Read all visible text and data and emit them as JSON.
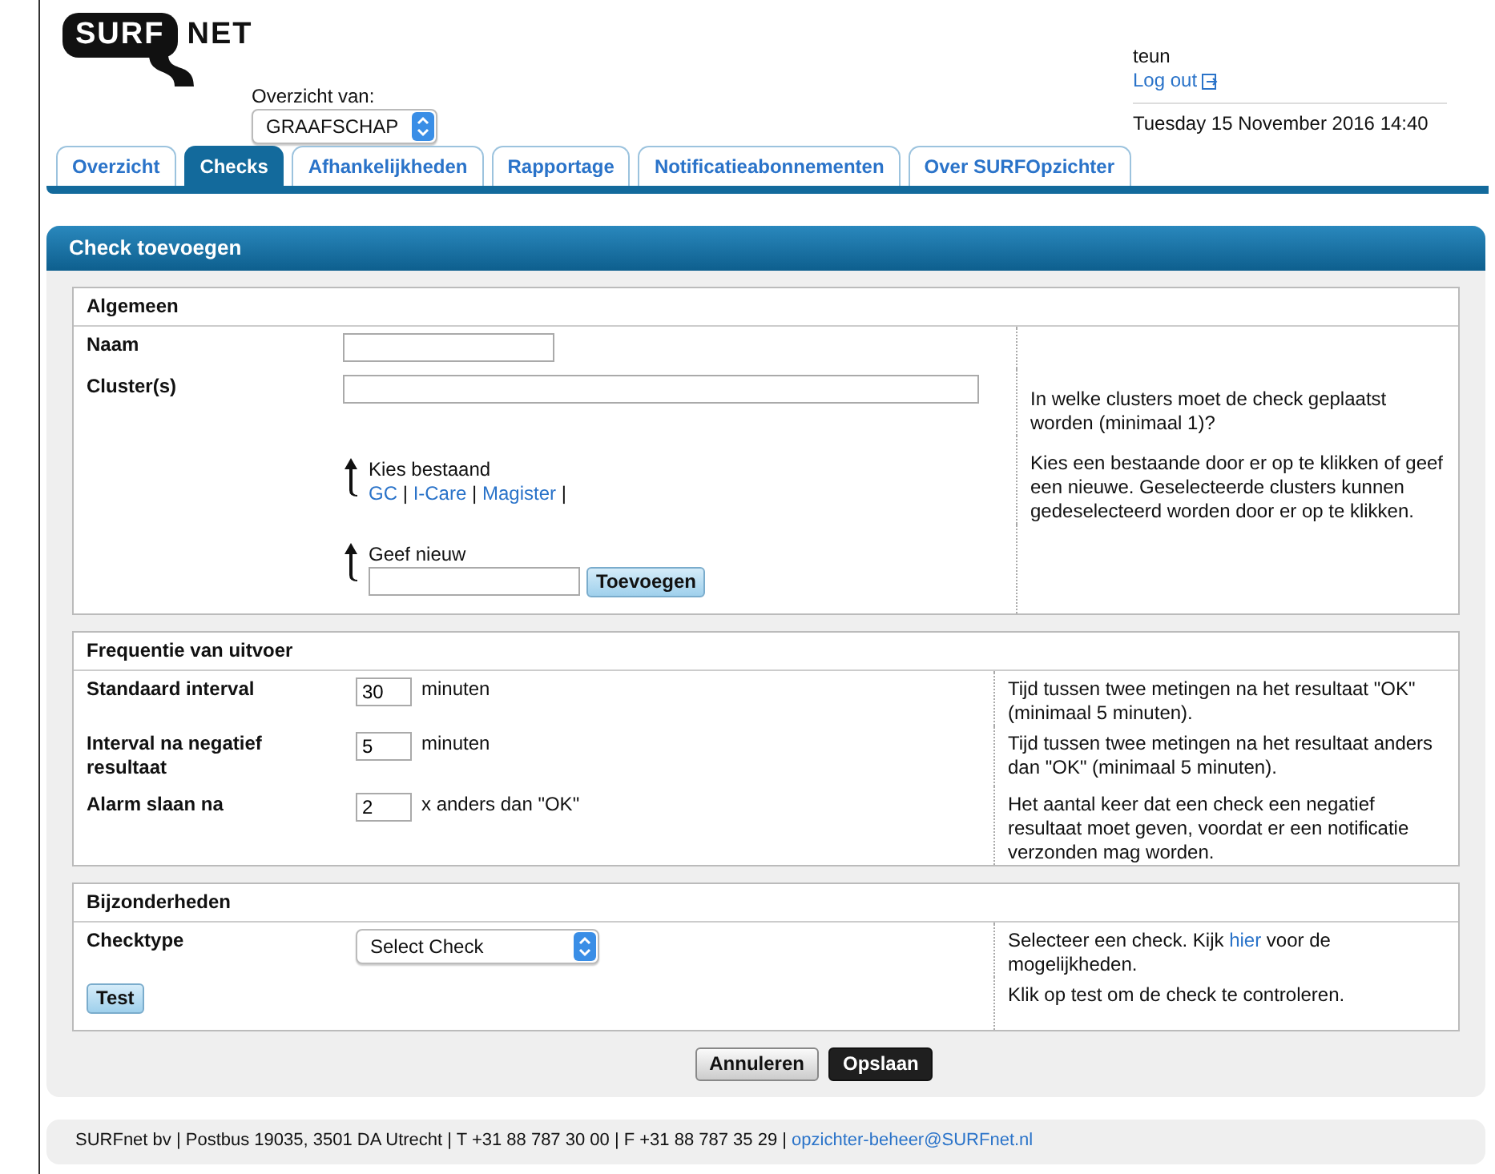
{
  "header": {
    "logo": {
      "left": "SURF",
      "right": "NET"
    },
    "overview_label": "Overzicht van:",
    "overview_select": "GRAAFSCHAP",
    "user": "teun",
    "logout": "Log out",
    "datetime": "Tuesday 15 November 2016 14:40"
  },
  "tabs": [
    {
      "label": "Overzicht",
      "selected": false
    },
    {
      "label": "Checks",
      "selected": true
    },
    {
      "label": "Afhankelijkheden",
      "selected": false
    },
    {
      "label": "Rapportage",
      "selected": false
    },
    {
      "label": "Notificatieabonnementen",
      "selected": false
    },
    {
      "label": "Over SURFOpzichter",
      "selected": false
    }
  ],
  "panel": {
    "title": "Check toevoegen",
    "sections": [
      {
        "title": "Algemeen",
        "rows": [
          {
            "kind": "short-input",
            "label": "Naam"
          },
          {
            "kind": "wide-input",
            "label": "Cluster(s)",
            "help": "In welke clusters moet de check geplaatst worden (minimaal 1)?"
          },
          {
            "kind": "choose-existing",
            "title": "Kies bestaand",
            "links": [
              "GC",
              "I-Care",
              "Magister"
            ],
            "separator": "|",
            "help": "Kies een bestaande door er op te klikken of geef een nieuwe. Geselecteerde clusters kunnen gedeselecteerd worden door er op te klikken."
          },
          {
            "kind": "add-new",
            "title": "Geef nieuw",
            "button": "Toevoegen"
          }
        ]
      },
      {
        "title": "Frequentie van uitvoer",
        "rows": [
          {
            "kind": "number-input",
            "label": "Standaard interval",
            "value": "30",
            "unit": "minuten",
            "help": "Tijd tussen twee metingen na het resultaat \"OK\" (minimaal 5 minuten)."
          },
          {
            "kind": "number-input",
            "label": "Interval na negatief resultaat",
            "value": "5",
            "unit": "minuten",
            "help": "Tijd tussen twee metingen na het resultaat anders dan \"OK\" (minimaal 5 minuten)."
          },
          {
            "kind": "number-input",
            "label": "Alarm slaan na",
            "value": "2",
            "unit": "x anders dan \"OK\"",
            "help": "Het aantal keer dat een check een negatief resultaat moet geven, voordat er een notificatie verzonden mag worden."
          }
        ]
      },
      {
        "title": "Bijzonderheden",
        "rows": [
          {
            "kind": "select",
            "label": "Checktype",
            "value": "Select Check",
            "help": {
              "before": "Selecteer een check. Kijk ",
              "link": "hier",
              "after": " voor de mogelijkheden."
            }
          },
          {
            "kind": "button",
            "button": "Test",
            "help": "Klik op test om de check te controleren."
          }
        ]
      }
    ],
    "buttons": [
      {
        "label": "Annuleren",
        "kind": "secondary"
      },
      {
        "label": "Opslaan",
        "kind": "primary"
      }
    ]
  },
  "footer": {
    "text": "SURFnet bv | Postbus 19035, 3501 DA Utrecht | T +31 88 787 30 00 | F +31 88 787 35 29 | ",
    "email": "opzichter-beheer@SURFnet.nl"
  }
}
